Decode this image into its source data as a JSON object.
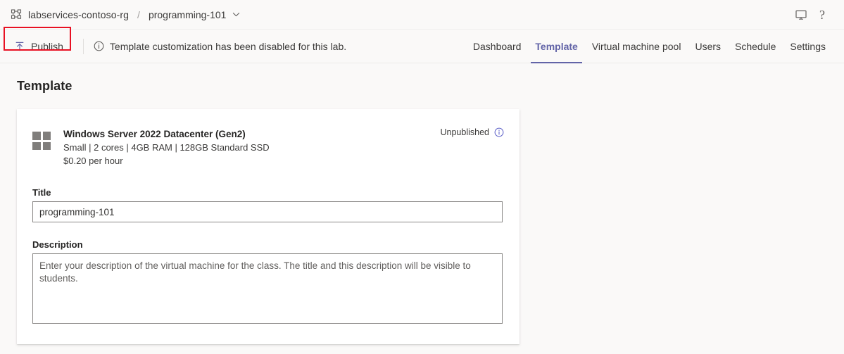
{
  "breadcrumb": {
    "icon": "resource-group-icon",
    "root_label": "labservices-contoso-rg",
    "separator": "/",
    "current_label": "programming-101",
    "chevron": "chevron-down-icon"
  },
  "titlebar": {
    "monitor_icon": "monitor-icon",
    "help_icon": "help-question-icon",
    "help_glyph": "?"
  },
  "command_bar": {
    "publish_label": "Publish",
    "publish_icon": "publish-upload-icon",
    "info_icon": "info-circle-icon",
    "message": "Template customization has been disabled for this lab.",
    "highlight_color": "#e81123",
    "accent_color": "#6264a7",
    "tabs": [
      {
        "label": "Dashboard",
        "active": false
      },
      {
        "label": "Template",
        "active": true
      },
      {
        "label": "Virtual machine pool",
        "active": false
      },
      {
        "label": "Users",
        "active": false
      },
      {
        "label": "Schedule",
        "active": false
      },
      {
        "label": "Settings",
        "active": false
      }
    ]
  },
  "page": {
    "title": "Template"
  },
  "template_card": {
    "os_icon": "windows-logo-icon",
    "vm_name": "Windows Server 2022 Datacenter (Gen2)",
    "vm_specs": "Small | 2 cores | 4GB RAM | 128GB Standard SSD",
    "vm_price": "$0.20 per hour",
    "status_text": "Unpublished",
    "status_info_icon": "info-circle-icon",
    "title_field": {
      "label": "Title",
      "value": "programming-101",
      "placeholder": ""
    },
    "description_field": {
      "label": "Description",
      "value": "",
      "placeholder": "Enter your description of the virtual machine for the class. The title and this description will be visible to students."
    }
  }
}
